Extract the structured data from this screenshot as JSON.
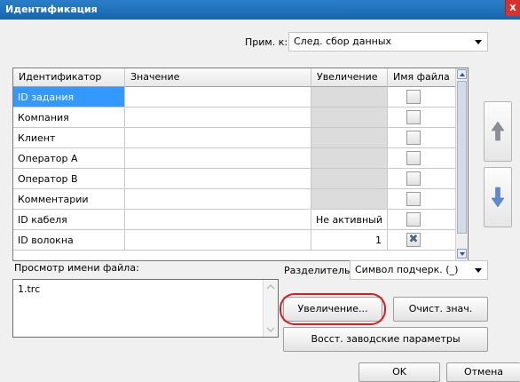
{
  "window": {
    "title": "Идентификация",
    "close_glyph": "x"
  },
  "apply": {
    "label": "Прим. к:",
    "value": "След. сбор данных"
  },
  "grid": {
    "headers": [
      "Идентификатор",
      "Значение",
      "Увеличение",
      "Имя файла"
    ],
    "rows": [
      {
        "id": "ID задания",
        "value": "",
        "increment": "",
        "file": false
      },
      {
        "id": "Компания",
        "value": "",
        "increment": "",
        "file": false
      },
      {
        "id": "Клиент",
        "value": "",
        "increment": "",
        "file": false
      },
      {
        "id": "Оператор A",
        "value": "",
        "increment": "",
        "file": false
      },
      {
        "id": "Оператор B",
        "value": "",
        "increment": "",
        "file": false
      },
      {
        "id": "Комментарии",
        "value": "",
        "increment": "",
        "file": false
      },
      {
        "id": "ID кабеля",
        "value": "",
        "increment": "Не активный",
        "file": false
      },
      {
        "id": "ID волокна",
        "value": "",
        "increment": "1",
        "file": true
      }
    ],
    "checked_glyph": "✖"
  },
  "preview": {
    "label": "Просмотр имени файла:",
    "value": "1.trc"
  },
  "separator": {
    "label": "Разделитель:",
    "value": "Символ подчерк. (_)"
  },
  "buttons": {
    "increment": "Увеличение...",
    "clear": "Очист. знач.",
    "restore": "Восст. заводские параметры",
    "ok": "OK",
    "cancel": "Отмена"
  },
  "colors": {
    "title_bar": "#1f75bf",
    "selection": "#3399ff",
    "arrow_icon": "#5f8ad0",
    "highlight": "#d42020"
  }
}
